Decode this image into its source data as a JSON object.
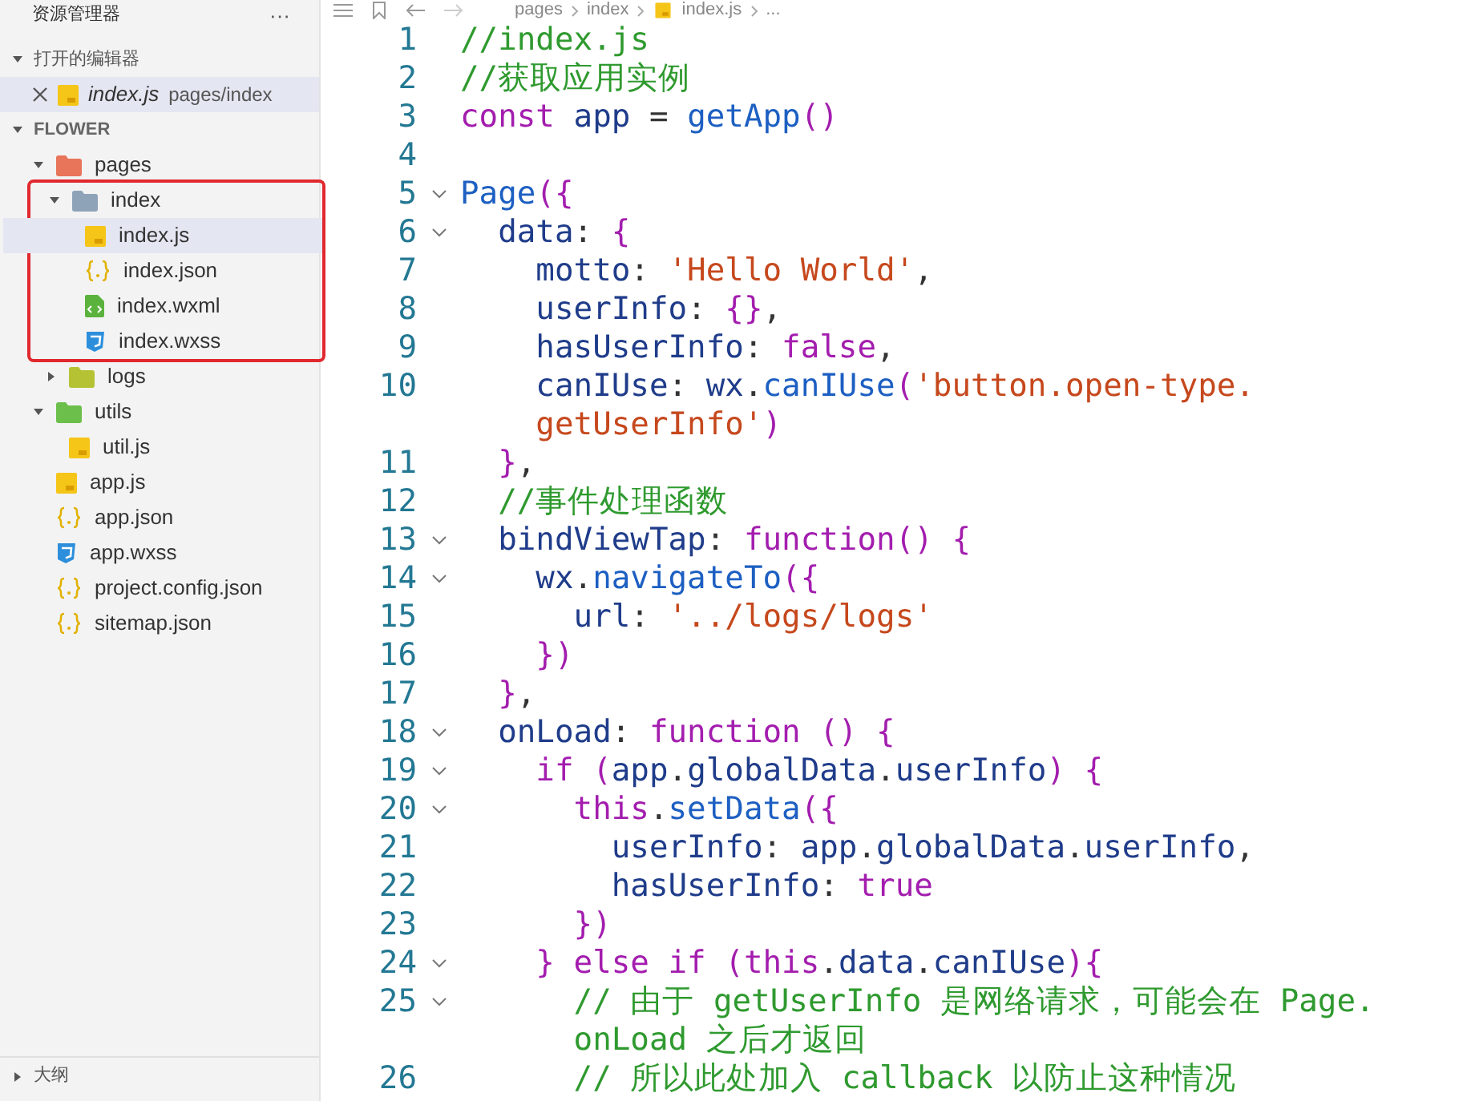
{
  "sidebar": {
    "title": "资源管理器",
    "more": "···",
    "open_editors": {
      "title": "打开的编辑器",
      "expanded": true,
      "items": [
        {
          "name": "index.js",
          "path": "pages/index",
          "selected": true
        }
      ]
    },
    "explorer": {
      "title": "FLOWER",
      "expanded": true,
      "tree": [
        {
          "label": "pages",
          "kind": "folder",
          "color": "#e8745a",
          "expanded": true,
          "selected": false,
          "outlined": false,
          "children": [
            {
              "label": "index",
              "kind": "folder",
              "color": "#8fa3b8",
              "expanded": true,
              "selected": false,
              "outlined": true,
              "children": [
                {
                  "label": "index.js",
                  "kind": "js",
                  "selected": true
                },
                {
                  "label": "index.json",
                  "kind": "json",
                  "selected": false
                },
                {
                  "label": "index.wxml",
                  "kind": "wxml",
                  "selected": false
                },
                {
                  "label": "index.wxss",
                  "kind": "wxss",
                  "selected": false
                }
              ]
            },
            {
              "label": "logs",
              "kind": "folder",
              "color": "#b5c234",
              "expanded": false,
              "selected": false,
              "outlined": false
            }
          ]
        },
        {
          "label": "utils",
          "kind": "folder",
          "color": "#6cbf4a",
          "expanded": true,
          "selected": false,
          "outlined": false,
          "children": [
            {
              "label": "util.js",
              "kind": "js",
              "selected": false
            }
          ]
        },
        {
          "label": "app.js",
          "kind": "js",
          "selected": false
        },
        {
          "label": "app.json",
          "kind": "json",
          "selected": false
        },
        {
          "label": "app.wxss",
          "kind": "wxss",
          "selected": false
        },
        {
          "label": "project.config.json",
          "kind": "json",
          "selected": false
        },
        {
          "label": "sitemap.json",
          "kind": "json",
          "selected": false
        }
      ]
    },
    "outline": {
      "title": "大纲",
      "expanded": false
    }
  },
  "breadcrumb": [
    {
      "label": "pages",
      "kind": "folder"
    },
    {
      "label": "index",
      "kind": "folder"
    },
    {
      "label": "index.js",
      "kind": "js"
    },
    {
      "label": "...",
      "kind": "more"
    }
  ],
  "code": [
    {
      "number": "1",
      "foldable": false,
      "tokens": [
        {
          "kind": "comment",
          "text": "//index.js"
        }
      ]
    },
    {
      "number": "2",
      "foldable": false,
      "tokens": [
        {
          "kind": "comment",
          "text": "//获取应用实例"
        }
      ]
    },
    {
      "number": "3",
      "foldable": false,
      "tokens": [
        {
          "kind": "keyword",
          "text": "const "
        },
        {
          "kind": "ident",
          "text": "app "
        },
        {
          "kind": "plain",
          "text": "= "
        },
        {
          "kind": "func",
          "text": "getApp"
        },
        {
          "kind": "punct",
          "text": "()"
        }
      ]
    },
    {
      "number": "4",
      "foldable": false
    },
    {
      "number": "5",
      "foldable": true,
      "tokens": [
        {
          "kind": "func",
          "text": "Page"
        },
        {
          "kind": "punct",
          "text": "({"
        }
      ]
    },
    {
      "number": "6",
      "foldable": true,
      "tokens": [
        {
          "kind": "ident",
          "text": "  data"
        },
        {
          "kind": "plain",
          "text": ": "
        },
        {
          "kind": "punct",
          "text": "{"
        }
      ]
    },
    {
      "number": "7",
      "foldable": false,
      "tokens": [
        {
          "kind": "ident",
          "text": "    motto"
        },
        {
          "kind": "plain",
          "text": ": "
        },
        {
          "kind": "string",
          "text": "'Hello World'"
        },
        {
          "kind": "plain",
          "text": ","
        }
      ]
    },
    {
      "number": "8",
      "foldable": false,
      "tokens": [
        {
          "kind": "ident",
          "text": "    userInfo"
        },
        {
          "kind": "plain",
          "text": ": "
        },
        {
          "kind": "punct",
          "text": "{}"
        },
        {
          "kind": "plain",
          "text": ","
        }
      ]
    },
    {
      "number": "9",
      "foldable": false,
      "tokens": [
        {
          "kind": "ident",
          "text": "    hasUserInfo"
        },
        {
          "kind": "plain",
          "text": ": "
        },
        {
          "kind": "keyword",
          "text": "false"
        },
        {
          "kind": "plain",
          "text": ","
        }
      ]
    },
    {
      "number": "10",
      "foldable": false,
      "tokens": [
        {
          "kind": "ident",
          "text": "    canIUse"
        },
        {
          "kind": "plain",
          "text": ": "
        },
        {
          "kind": "ident",
          "text": "wx"
        },
        {
          "kind": "plain",
          "text": "."
        },
        {
          "kind": "func",
          "text": "canIUse"
        },
        {
          "kind": "punct",
          "text": "("
        },
        {
          "kind": "string",
          "text": "'button.open-type."
        }
      ],
      "wrap": [
        {
          "kind": "string",
          "text": "    getUserInfo'"
        },
        {
          "kind": "punct",
          "text": ")"
        }
      ]
    },
    {
      "number": "11",
      "foldable": false,
      "tokens": [
        {
          "kind": "punct",
          "text": "  }"
        },
        {
          "kind": "plain",
          "text": ","
        }
      ]
    },
    {
      "number": "12",
      "foldable": false,
      "tokens": [
        {
          "kind": "comment",
          "text": "  //事件处理函数"
        }
      ]
    },
    {
      "number": "13",
      "foldable": true,
      "tokens": [
        {
          "kind": "ident",
          "text": "  bindViewTap"
        },
        {
          "kind": "plain",
          "text": ": "
        },
        {
          "kind": "keyword",
          "text": "function"
        },
        {
          "kind": "punct",
          "text": "() {"
        }
      ]
    },
    {
      "number": "14",
      "foldable": true,
      "tokens": [
        {
          "kind": "ident",
          "text": "    wx"
        },
        {
          "kind": "plain",
          "text": "."
        },
        {
          "kind": "func",
          "text": "navigateTo"
        },
        {
          "kind": "punct",
          "text": "({"
        }
      ]
    },
    {
      "number": "15",
      "foldable": false,
      "tokens": [
        {
          "kind": "ident",
          "text": "      url"
        },
        {
          "kind": "plain",
          "text": ": "
        },
        {
          "kind": "string",
          "text": "'../logs/logs'"
        }
      ]
    },
    {
      "number": "16",
      "foldable": false,
      "tokens": [
        {
          "kind": "punct",
          "text": "    })"
        }
      ]
    },
    {
      "number": "17",
      "foldable": false,
      "tokens": [
        {
          "kind": "punct",
          "text": "  }"
        },
        {
          "kind": "plain",
          "text": ","
        }
      ]
    },
    {
      "number": "18",
      "foldable": true,
      "tokens": [
        {
          "kind": "ident",
          "text": "  onLoad"
        },
        {
          "kind": "plain",
          "text": ": "
        },
        {
          "kind": "keyword",
          "text": "function "
        },
        {
          "kind": "punct",
          "text": "() {"
        }
      ]
    },
    {
      "number": "19",
      "foldable": true,
      "tokens": [
        {
          "kind": "keyword",
          "text": "    if "
        },
        {
          "kind": "punct",
          "text": "("
        },
        {
          "kind": "ident",
          "text": "app"
        },
        {
          "kind": "plain",
          "text": "."
        },
        {
          "kind": "ident",
          "text": "globalData"
        },
        {
          "kind": "plain",
          "text": "."
        },
        {
          "kind": "ident",
          "text": "userInfo"
        },
        {
          "kind": "punct",
          "text": ") {"
        }
      ]
    },
    {
      "number": "20",
      "foldable": true,
      "tokens": [
        {
          "kind": "keyword",
          "text": "      this"
        },
        {
          "kind": "plain",
          "text": "."
        },
        {
          "kind": "func",
          "text": "setData"
        },
        {
          "kind": "punct",
          "text": "({"
        }
      ]
    },
    {
      "number": "21",
      "foldable": false,
      "tokens": [
        {
          "kind": "ident",
          "text": "        userInfo"
        },
        {
          "kind": "plain",
          "text": ": "
        },
        {
          "kind": "ident",
          "text": "app"
        },
        {
          "kind": "plain",
          "text": "."
        },
        {
          "kind": "ident",
          "text": "globalData"
        },
        {
          "kind": "plain",
          "text": "."
        },
        {
          "kind": "ident",
          "text": "userInfo"
        },
        {
          "kind": "plain",
          "text": ","
        }
      ]
    },
    {
      "number": "22",
      "foldable": false,
      "tokens": [
        {
          "kind": "ident",
          "text": "        hasUserInfo"
        },
        {
          "kind": "plain",
          "text": ": "
        },
        {
          "kind": "keyword",
          "text": "true"
        }
      ]
    },
    {
      "number": "23",
      "foldable": false,
      "tokens": [
        {
          "kind": "punct",
          "text": "      })"
        }
      ]
    },
    {
      "number": "24",
      "foldable": true,
      "tokens": [
        {
          "kind": "punct",
          "text": "    } "
        },
        {
          "kind": "keyword",
          "text": "else if "
        },
        {
          "kind": "punct",
          "text": "("
        },
        {
          "kind": "keyword",
          "text": "this"
        },
        {
          "kind": "plain",
          "text": "."
        },
        {
          "kind": "ident",
          "text": "data"
        },
        {
          "kind": "plain",
          "text": "."
        },
        {
          "kind": "ident",
          "text": "canIUse"
        },
        {
          "kind": "punct",
          "text": "){"
        }
      ]
    },
    {
      "number": "25",
      "foldable": true,
      "tokens": [
        {
          "kind": "comment",
          "text": "      // 由于 getUserInfo 是网络请求，可能会在 Page."
        }
      ],
      "wrap": [
        {
          "kind": "comment",
          "text": "      onLoad 之后才返回"
        }
      ]
    },
    {
      "number": "26",
      "foldable": false,
      "tokens": [
        {
          "kind": "comment",
          "text": "      // 所以此处加入 callback 以防止这种情况"
        }
      ]
    }
  ]
}
